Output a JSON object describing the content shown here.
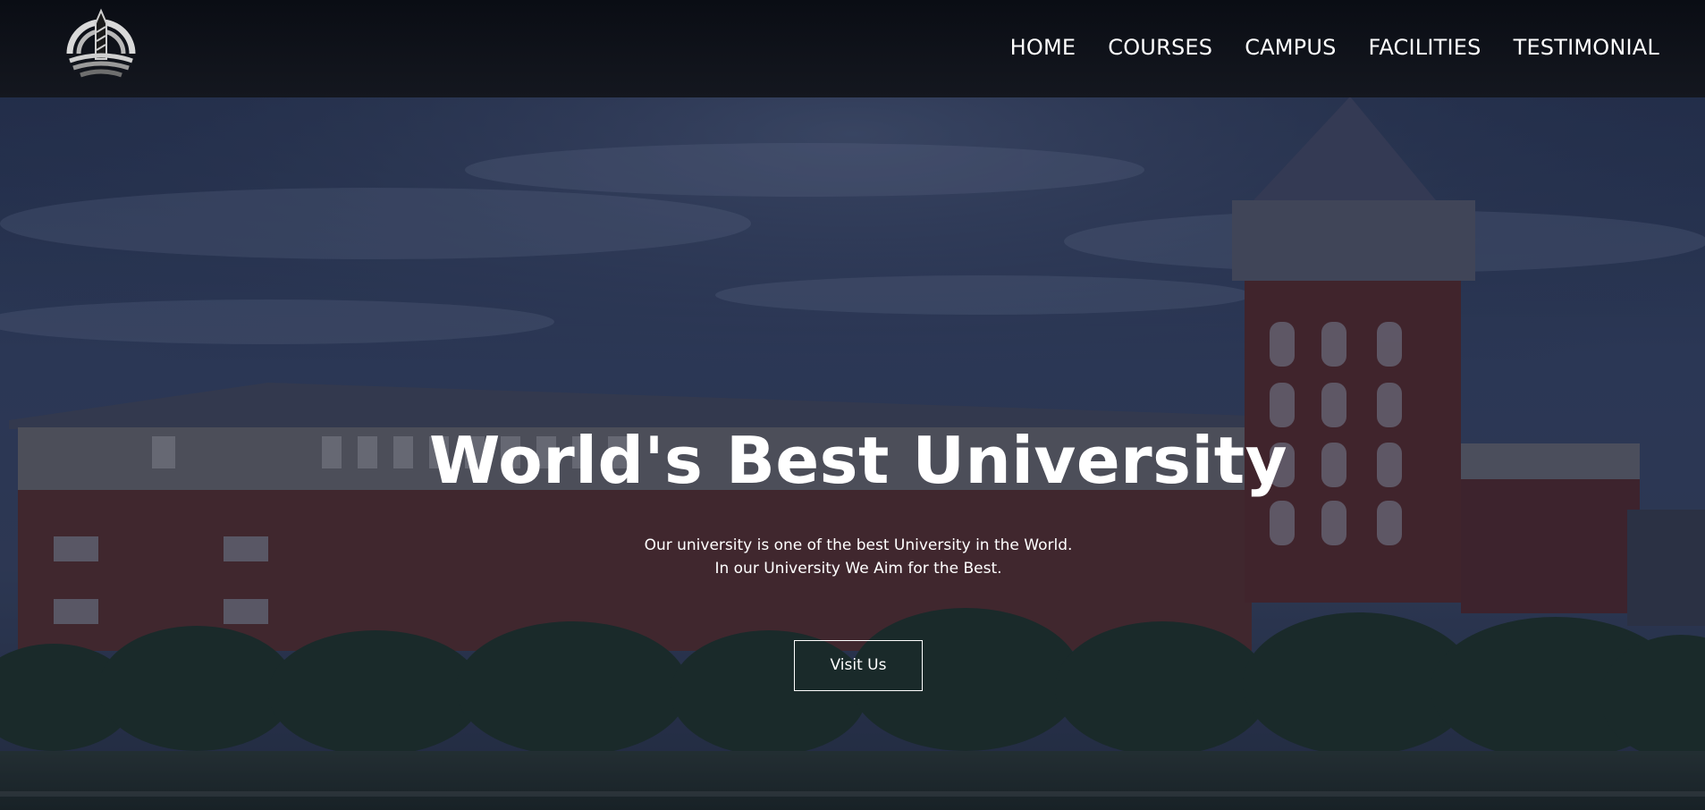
{
  "header": {
    "logo_icon": "university-pen-logo",
    "nav": [
      {
        "label": "HOME"
      },
      {
        "label": "COURSES"
      },
      {
        "label": "CAMPUS"
      },
      {
        "label": "FACILITIES"
      },
      {
        "label": "TESTIMONIAL"
      }
    ]
  },
  "hero": {
    "title": "World's Best University",
    "subtitle_line1": "Our university is one of the best University in the World.",
    "subtitle_line2": "In our University We Aim for the Best.",
    "button_label": "Visit Us",
    "background_image": "university-campus-photo"
  },
  "colors": {
    "header_bg": "#0f121a",
    "overlay": "#1a2540",
    "text": "#ffffff"
  }
}
